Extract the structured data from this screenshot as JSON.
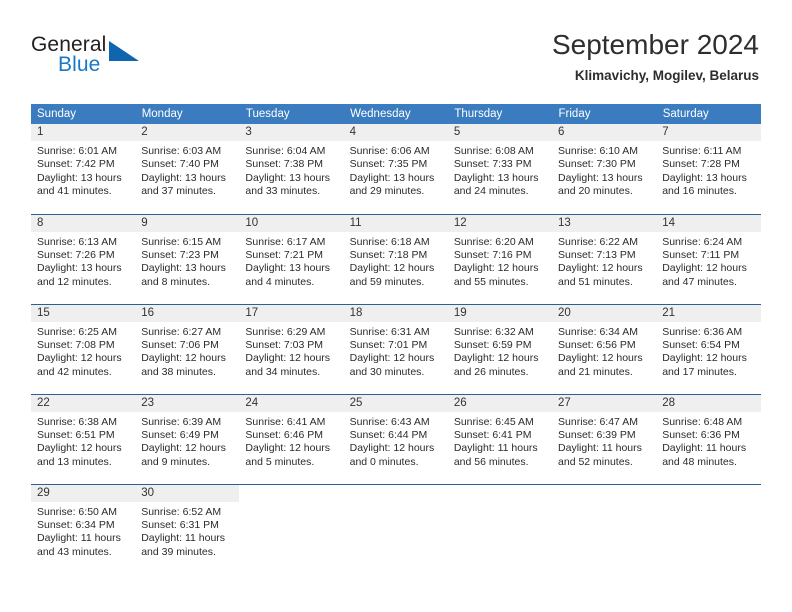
{
  "brand": {
    "name_part1": "General",
    "name_part2": "Blue",
    "logo_icon": "triangle-flag-icon"
  },
  "header": {
    "title": "September 2024",
    "subtitle": "Klimavichy, Mogilev, Belarus"
  },
  "colors": {
    "header_row_background": "#3a7cbf",
    "row_divider": "#2b5f96",
    "day_number_band": "#efefef",
    "brand_blue": "#1878c8",
    "text": "#2b2b2b"
  },
  "labels": {
    "sunrise_prefix": "Sunrise:",
    "sunset_prefix": "Sunset:",
    "daylight_prefix": "Daylight:"
  },
  "weekdays": [
    "Sunday",
    "Monday",
    "Tuesday",
    "Wednesday",
    "Thursday",
    "Friday",
    "Saturday"
  ],
  "weeks": [
    [
      {
        "day": "1",
        "sunrise": "Sunrise: 6:01 AM",
        "sunset": "Sunset: 7:42 PM",
        "daylight1": "Daylight: 13 hours",
        "daylight2": "and 41 minutes."
      },
      {
        "day": "2",
        "sunrise": "Sunrise: 6:03 AM",
        "sunset": "Sunset: 7:40 PM",
        "daylight1": "Daylight: 13 hours",
        "daylight2": "and 37 minutes."
      },
      {
        "day": "3",
        "sunrise": "Sunrise: 6:04 AM",
        "sunset": "Sunset: 7:38 PM",
        "daylight1": "Daylight: 13 hours",
        "daylight2": "and 33 minutes."
      },
      {
        "day": "4",
        "sunrise": "Sunrise: 6:06 AM",
        "sunset": "Sunset: 7:35 PM",
        "daylight1": "Daylight: 13 hours",
        "daylight2": "and 29 minutes."
      },
      {
        "day": "5",
        "sunrise": "Sunrise: 6:08 AM",
        "sunset": "Sunset: 7:33 PM",
        "daylight1": "Daylight: 13 hours",
        "daylight2": "and 24 minutes."
      },
      {
        "day": "6",
        "sunrise": "Sunrise: 6:10 AM",
        "sunset": "Sunset: 7:30 PM",
        "daylight1": "Daylight: 13 hours",
        "daylight2": "and 20 minutes."
      },
      {
        "day": "7",
        "sunrise": "Sunrise: 6:11 AM",
        "sunset": "Sunset: 7:28 PM",
        "daylight1": "Daylight: 13 hours",
        "daylight2": "and 16 minutes."
      }
    ],
    [
      {
        "day": "8",
        "sunrise": "Sunrise: 6:13 AM",
        "sunset": "Sunset: 7:26 PM",
        "daylight1": "Daylight: 13 hours",
        "daylight2": "and 12 minutes."
      },
      {
        "day": "9",
        "sunrise": "Sunrise: 6:15 AM",
        "sunset": "Sunset: 7:23 PM",
        "daylight1": "Daylight: 13 hours",
        "daylight2": "and 8 minutes."
      },
      {
        "day": "10",
        "sunrise": "Sunrise: 6:17 AM",
        "sunset": "Sunset: 7:21 PM",
        "daylight1": "Daylight: 13 hours",
        "daylight2": "and 4 minutes."
      },
      {
        "day": "11",
        "sunrise": "Sunrise: 6:18 AM",
        "sunset": "Sunset: 7:18 PM",
        "daylight1": "Daylight: 12 hours",
        "daylight2": "and 59 minutes."
      },
      {
        "day": "12",
        "sunrise": "Sunrise: 6:20 AM",
        "sunset": "Sunset: 7:16 PM",
        "daylight1": "Daylight: 12 hours",
        "daylight2": "and 55 minutes."
      },
      {
        "day": "13",
        "sunrise": "Sunrise: 6:22 AM",
        "sunset": "Sunset: 7:13 PM",
        "daylight1": "Daylight: 12 hours",
        "daylight2": "and 51 minutes."
      },
      {
        "day": "14",
        "sunrise": "Sunrise: 6:24 AM",
        "sunset": "Sunset: 7:11 PM",
        "daylight1": "Daylight: 12 hours",
        "daylight2": "and 47 minutes."
      }
    ],
    [
      {
        "day": "15",
        "sunrise": "Sunrise: 6:25 AM",
        "sunset": "Sunset: 7:08 PM",
        "daylight1": "Daylight: 12 hours",
        "daylight2": "and 42 minutes."
      },
      {
        "day": "16",
        "sunrise": "Sunrise: 6:27 AM",
        "sunset": "Sunset: 7:06 PM",
        "daylight1": "Daylight: 12 hours",
        "daylight2": "and 38 minutes."
      },
      {
        "day": "17",
        "sunrise": "Sunrise: 6:29 AM",
        "sunset": "Sunset: 7:03 PM",
        "daylight1": "Daylight: 12 hours",
        "daylight2": "and 34 minutes."
      },
      {
        "day": "18",
        "sunrise": "Sunrise: 6:31 AM",
        "sunset": "Sunset: 7:01 PM",
        "daylight1": "Daylight: 12 hours",
        "daylight2": "and 30 minutes."
      },
      {
        "day": "19",
        "sunrise": "Sunrise: 6:32 AM",
        "sunset": "Sunset: 6:59 PM",
        "daylight1": "Daylight: 12 hours",
        "daylight2": "and 26 minutes."
      },
      {
        "day": "20",
        "sunrise": "Sunrise: 6:34 AM",
        "sunset": "Sunset: 6:56 PM",
        "daylight1": "Daylight: 12 hours",
        "daylight2": "and 21 minutes."
      },
      {
        "day": "21",
        "sunrise": "Sunrise: 6:36 AM",
        "sunset": "Sunset: 6:54 PM",
        "daylight1": "Daylight: 12 hours",
        "daylight2": "and 17 minutes."
      }
    ],
    [
      {
        "day": "22",
        "sunrise": "Sunrise: 6:38 AM",
        "sunset": "Sunset: 6:51 PM",
        "daylight1": "Daylight: 12 hours",
        "daylight2": "and 13 minutes."
      },
      {
        "day": "23",
        "sunrise": "Sunrise: 6:39 AM",
        "sunset": "Sunset: 6:49 PM",
        "daylight1": "Daylight: 12 hours",
        "daylight2": "and 9 minutes."
      },
      {
        "day": "24",
        "sunrise": "Sunrise: 6:41 AM",
        "sunset": "Sunset: 6:46 PM",
        "daylight1": "Daylight: 12 hours",
        "daylight2": "and 5 minutes."
      },
      {
        "day": "25",
        "sunrise": "Sunrise: 6:43 AM",
        "sunset": "Sunset: 6:44 PM",
        "daylight1": "Daylight: 12 hours",
        "daylight2": "and 0 minutes."
      },
      {
        "day": "26",
        "sunrise": "Sunrise: 6:45 AM",
        "sunset": "Sunset: 6:41 PM",
        "daylight1": "Daylight: 11 hours",
        "daylight2": "and 56 minutes."
      },
      {
        "day": "27",
        "sunrise": "Sunrise: 6:47 AM",
        "sunset": "Sunset: 6:39 PM",
        "daylight1": "Daylight: 11 hours",
        "daylight2": "and 52 minutes."
      },
      {
        "day": "28",
        "sunrise": "Sunrise: 6:48 AM",
        "sunset": "Sunset: 6:36 PM",
        "daylight1": "Daylight: 11 hours",
        "daylight2": "and 48 minutes."
      }
    ],
    [
      {
        "day": "29",
        "sunrise": "Sunrise: 6:50 AM",
        "sunset": "Sunset: 6:34 PM",
        "daylight1": "Daylight: 11 hours",
        "daylight2": "and 43 minutes."
      },
      {
        "day": "30",
        "sunrise": "Sunrise: 6:52 AM",
        "sunset": "Sunset: 6:31 PM",
        "daylight1": "Daylight: 11 hours",
        "daylight2": "and 39 minutes."
      },
      {
        "day": "",
        "sunrise": "",
        "sunset": "",
        "daylight1": "",
        "daylight2": ""
      },
      {
        "day": "",
        "sunrise": "",
        "sunset": "",
        "daylight1": "",
        "daylight2": ""
      },
      {
        "day": "",
        "sunrise": "",
        "sunset": "",
        "daylight1": "",
        "daylight2": ""
      },
      {
        "day": "",
        "sunrise": "",
        "sunset": "",
        "daylight1": "",
        "daylight2": ""
      },
      {
        "day": "",
        "sunrise": "",
        "sunset": "",
        "daylight1": "",
        "daylight2": ""
      }
    ]
  ]
}
